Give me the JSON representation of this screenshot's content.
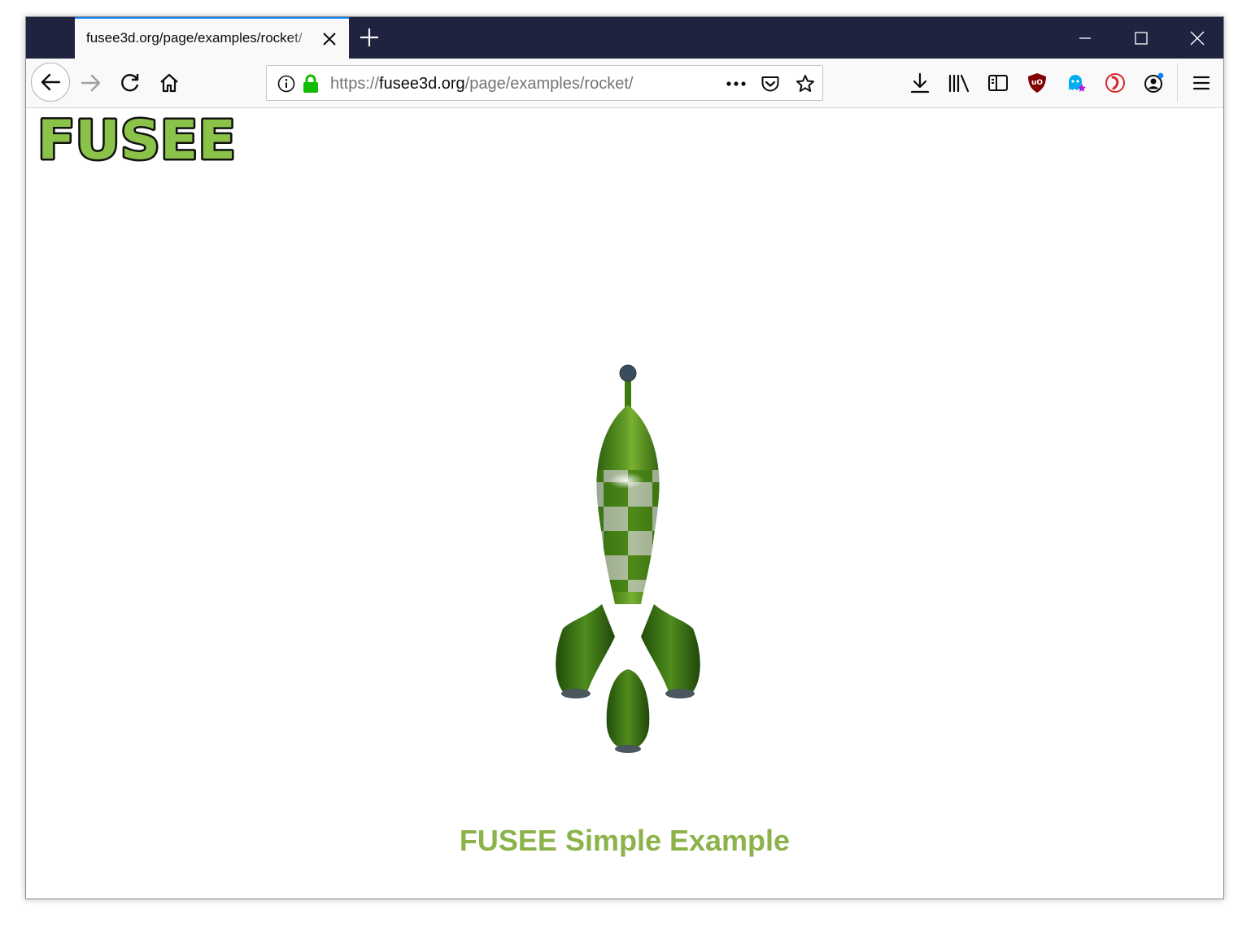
{
  "browser": {
    "tab": {
      "title": "fusee3d.org/page/examples/rocket/"
    },
    "url": {
      "scheme": "https://",
      "host": "fusee3d.org",
      "path": "/page/examples/rocket/"
    }
  },
  "page": {
    "logo_text": "FUSEE",
    "caption": "FUSEE Simple Example"
  },
  "colors": {
    "titlebar": "#202340",
    "tab_accent": "#0a84ff",
    "brand_green": "#8bb34a",
    "rocket_green": "#3f7a10",
    "rocket_silver": "#c6c6c6"
  },
  "icons": {
    "toolbar": [
      "back-icon",
      "forward-icon",
      "reload-icon",
      "home-icon",
      "info-icon",
      "lock-icon",
      "page-actions-icon",
      "pocket-icon",
      "bookmark-star-icon",
      "downloads-icon",
      "library-icon",
      "sidebar-icon",
      "ublock-icon",
      "ghostery-icon",
      "extension-icon",
      "account-icon",
      "menu-icon"
    ]
  }
}
